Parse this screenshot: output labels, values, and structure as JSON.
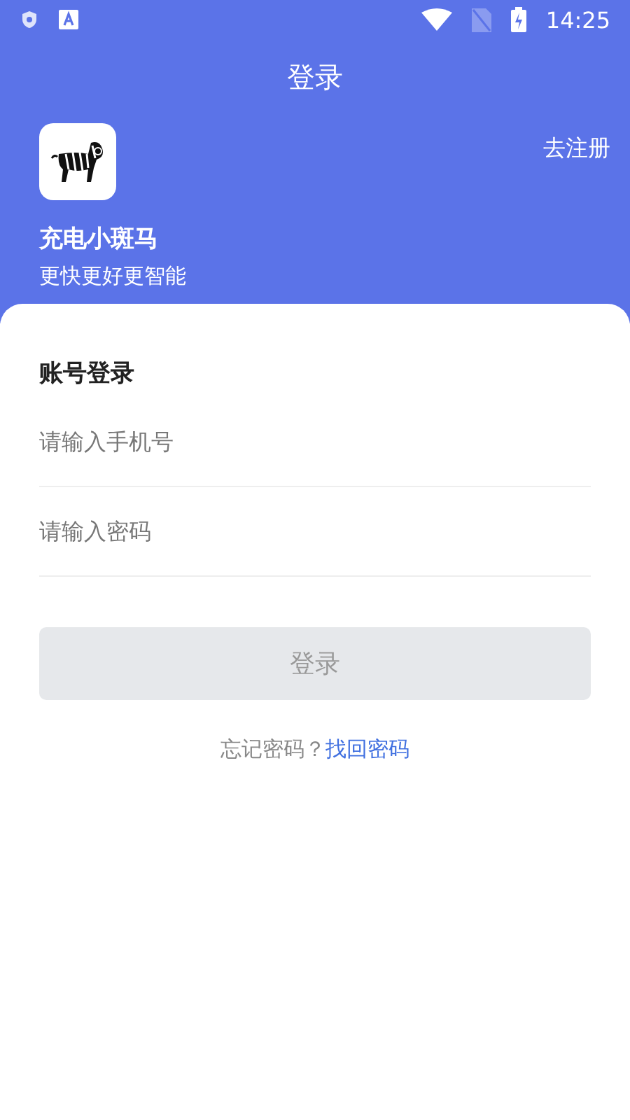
{
  "status_bar": {
    "time": "14:25"
  },
  "header": {
    "title": "登录",
    "register_link": "去注册",
    "app_name": "充电小斑马",
    "slogan": "更快更好更智能"
  },
  "form": {
    "heading": "账号登录",
    "fields": [
      {
        "placeholder": "请输入手机号"
      },
      {
        "placeholder": "请输入密码"
      }
    ],
    "login_button": {
      "label": "登录",
      "disabled": true
    },
    "forgot_prompt": "忘记密码？",
    "recover_link": "找回密码"
  }
}
